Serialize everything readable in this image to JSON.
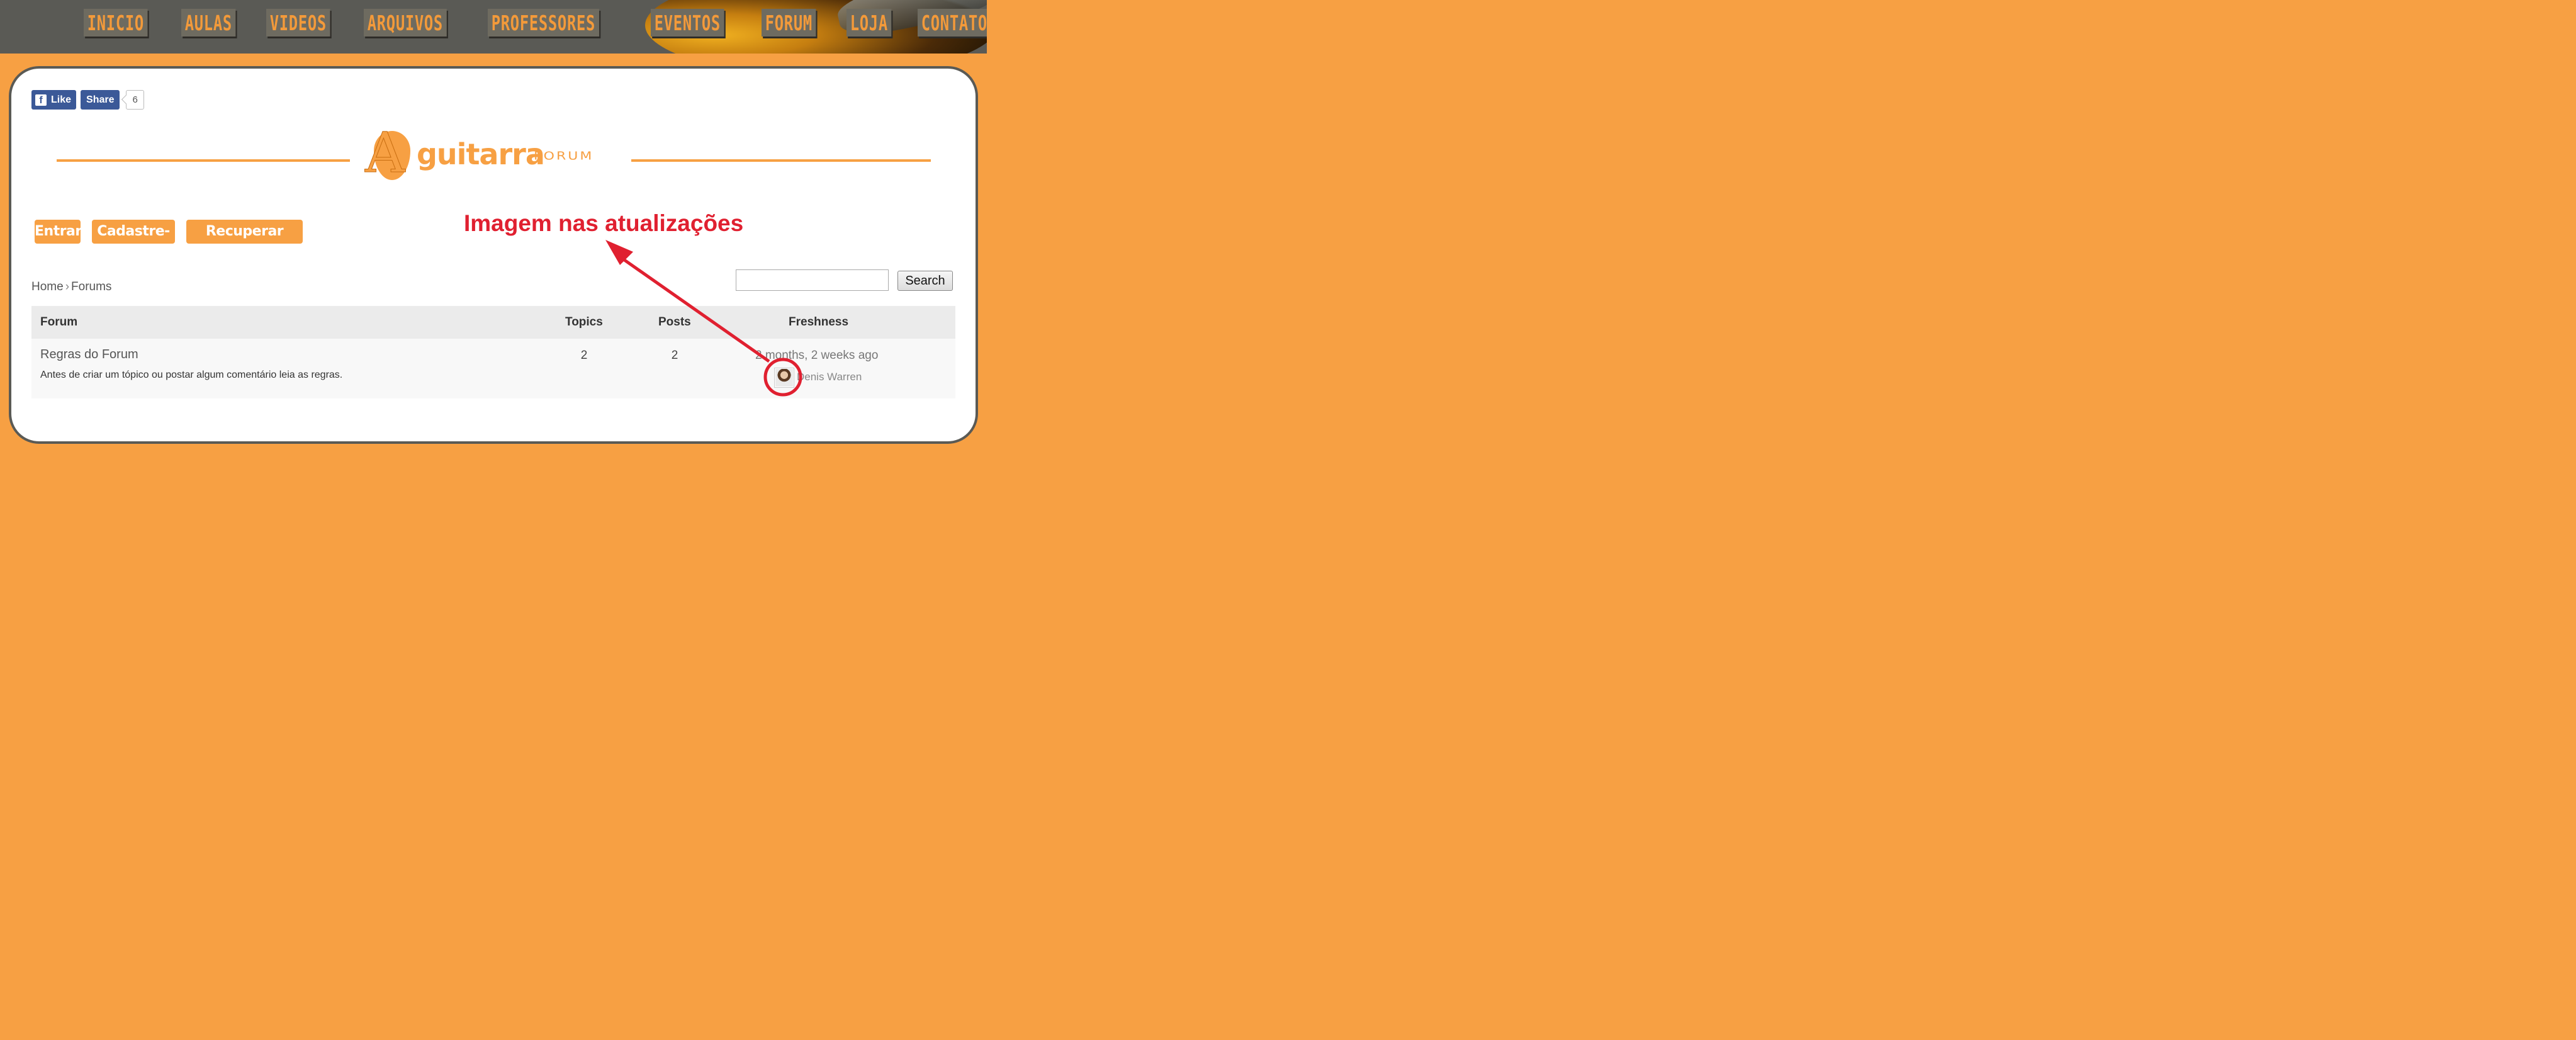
{
  "nav": {
    "items": [
      "INICIO",
      "AULAS",
      "VIDEOS",
      "ARQUIVOS",
      "PROFESSORES",
      "EVENTOS",
      "FORUM",
      "LOJA",
      "CONTATO"
    ]
  },
  "social": {
    "like_label": "Like",
    "share_label": "Share",
    "count": "6",
    "like_icon": "facebook-f-icon"
  },
  "logo": {
    "letter": "A",
    "word": "guitarra",
    "forum": "FORUM"
  },
  "auth": {
    "login": "Entrar",
    "register": "Cadastre-se",
    "recover": "Recuperar Senha"
  },
  "annotation": {
    "text": "Imagem nas atualizações",
    "color": "#e02030"
  },
  "breadcrumb": {
    "home": "Home",
    "separator": "›",
    "current": "Forums"
  },
  "search": {
    "value": "",
    "button_label": "Search"
  },
  "table": {
    "headers": {
      "forum": "Forum",
      "topics": "Topics",
      "posts": "Posts",
      "freshness": "Freshness"
    },
    "rows": [
      {
        "title": "Regras do Forum",
        "description": "Antes de criar um tópico ou postar algum comentário leia as regras.",
        "topics": "2",
        "posts": "2",
        "freshness": "2 months, 2 weeks ago",
        "author": "Denis Warren"
      }
    ]
  },
  "colors": {
    "accent": "#f7a043",
    "nav_bg": "#5a5a55",
    "facebook": "#3b5998"
  }
}
